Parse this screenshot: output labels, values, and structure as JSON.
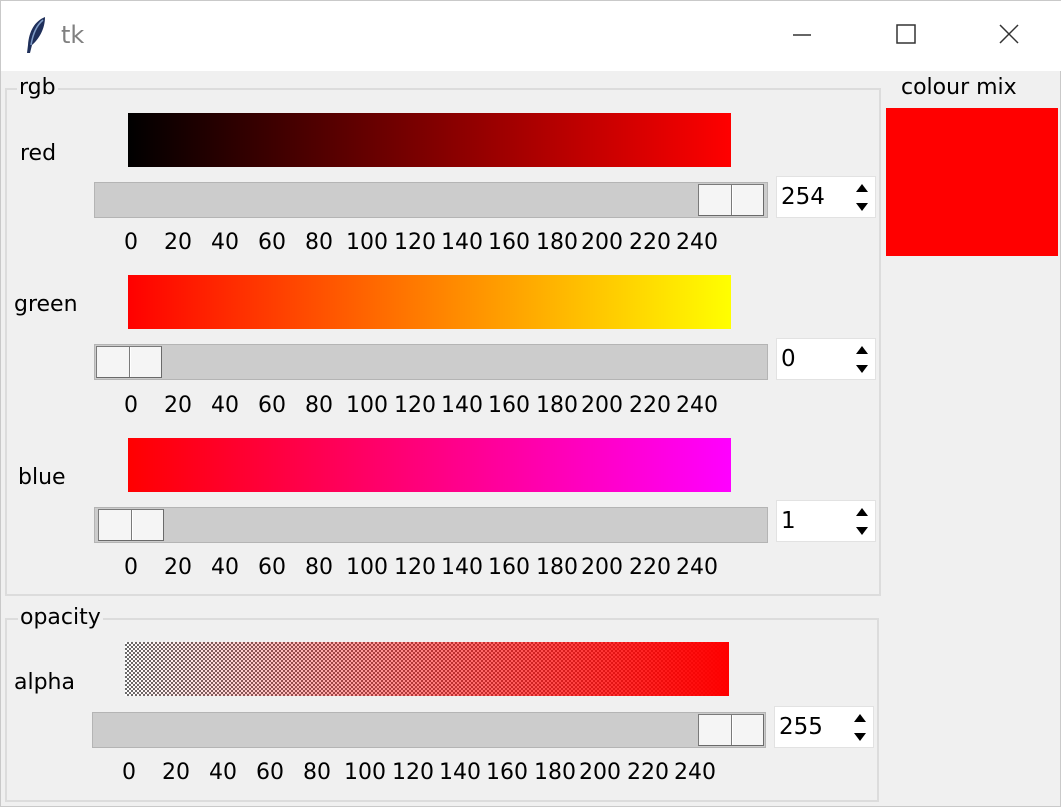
{
  "window": {
    "title": "tk",
    "controls": {
      "minimize": "minimize-icon",
      "maximize": "maximize-icon",
      "close": "close-icon"
    }
  },
  "rgb_frame": {
    "label": "rgb",
    "rows": [
      {
        "id": "red",
        "label": "red",
        "value": "254",
        "slider_fraction": 0.996,
        "swatch_from": "#000000",
        "swatch_to": "#ff0000"
      },
      {
        "id": "green",
        "label": "green",
        "value": "0",
        "slider_fraction": 0.0,
        "swatch_from": "#ff0000",
        "swatch_to": "#ffff00"
      },
      {
        "id": "blue",
        "label": "blue",
        "value": "1",
        "slider_fraction": 0.004,
        "swatch_from": "#ff0000",
        "swatch_to": "#ff00ff"
      }
    ]
  },
  "opacity_frame": {
    "label": "opacity",
    "rows": [
      {
        "id": "alpha",
        "label": "alpha",
        "value": "255",
        "slider_fraction": 1.0,
        "swatch_from": "rgba(255,0,0,0)",
        "swatch_to": "#ff0000"
      }
    ]
  },
  "scale_ticks": [
    "0",
    "20",
    "40",
    "60",
    "80",
    "100",
    "120",
    "140",
    "160",
    "180",
    "200",
    "220",
    "240"
  ],
  "colour_mix": {
    "label": "colour mix",
    "color": "#ff0000"
  }
}
